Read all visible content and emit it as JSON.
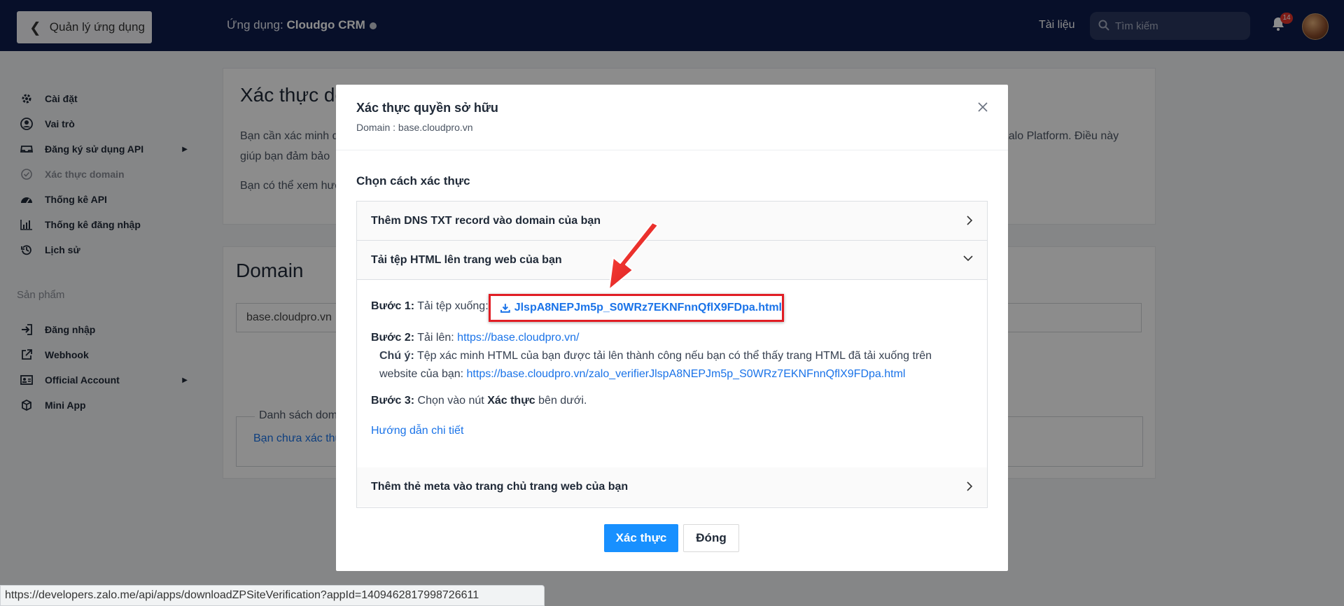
{
  "header": {
    "back_label": "Quản lý ứng dụng",
    "app_prefix": "Ứng dụng:",
    "app_name": "Cloudgo CRM",
    "docs_label": "Tài liệu",
    "search_placeholder": "Tìm kiếm",
    "notification_count": "14"
  },
  "sidebar": {
    "items": [
      {
        "label": "Cài đặt",
        "icon": "gear-icon"
      },
      {
        "label": "Vai trò",
        "icon": "user-circle-icon"
      },
      {
        "label": "Đăng ký sử dụng API",
        "icon": "inbox-icon"
      },
      {
        "label": "Xác thực domain",
        "icon": "check-circle-icon"
      },
      {
        "label": "Thống kê API",
        "icon": "dashboard-icon"
      },
      {
        "label": "Thống kê đăng nhập",
        "icon": "bar-chart-icon"
      },
      {
        "label": "Lịch sử",
        "icon": "history-icon"
      }
    ],
    "section_label": "Sản phẩm",
    "products": [
      {
        "label": "Đăng nhập",
        "icon": "login-icon"
      },
      {
        "label": "Webhook",
        "icon": "external-link-icon"
      },
      {
        "label": "Official Account",
        "icon": "id-card-icon"
      },
      {
        "label": "Mini App",
        "icon": "cube-icon"
      }
    ]
  },
  "background": {
    "card1_title": "Xác thực do",
    "card1_p1": "Bạn cần xác minh d",
    "card1_p1b": "giúp bạn đảm bảo",
    "card1_p1_right": "Zalo Platform. Điều này",
    "card1_p2": "Bạn có thể xem hướ",
    "card2_title": "Domain",
    "domain_value": "base.cloudpro.vn",
    "list_legend": "Danh sách dom",
    "list_empty": "Bạn chưa xác thự"
  },
  "modal": {
    "title": "Xác thực quyền sở hữu",
    "subtitle": "Domain : base.cloudpro.vn",
    "choose_label": "Chọn cách xác thực",
    "options": [
      "Thêm DNS TXT record vào domain của bạn",
      "Tải tệp HTML lên trang web của bạn",
      "Thêm thẻ meta vào trang chủ trang web của bạn"
    ],
    "step1_label": "Bước 1:",
    "step1_text": "Tải tệp xuống:",
    "download_file": "JlspA8NEPJm5p_S0WRz7EKNFnnQflX9FDpa.html",
    "step2_label": "Bước 2:",
    "step2_text": "Tải lên:",
    "step2_link": "https://base.cloudpro.vn/",
    "note_label": "Chú ý:",
    "note_text": "Tệp xác minh HTML của bạn được tải lên thành công nếu bạn có thể thấy trang HTML đã tải xuống trên",
    "note_text2": "website của bạn:",
    "note_link": "https://base.cloudpro.vn/zalo_verifierJlspA8NEPJm5p_S0WRz7EKNFnnQflX9FDpa.html",
    "step3_label": "Bước 3:",
    "step3_text_a": "Chọn vào nút",
    "step3_bold": "Xác thực",
    "step3_text_b": "bên dưới.",
    "detail_link": "Hướng dẫn chi tiết",
    "verify_button": "Xác thực",
    "close_button": "Đóng"
  },
  "status_url": "https://developers.zalo.me/api/apps/downloadZPSiteVerification?appId=1409462817998726611",
  "colors": {
    "header_bg": "#0e1d4c",
    "primary": "#1890ff",
    "link": "#1a73e8",
    "highlight": "#e11d24"
  }
}
